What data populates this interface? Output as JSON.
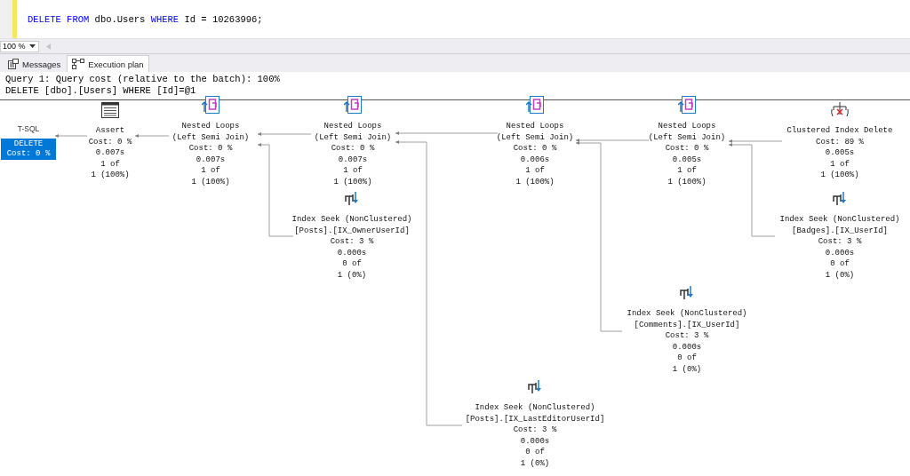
{
  "editor": {
    "code": [
      {
        "text": "DELETE FROM",
        "kind": "keyword"
      },
      {
        "text": " dbo.Users ",
        "kind": "plain"
      },
      {
        "text": "WHERE",
        "kind": "keyword"
      },
      {
        "text": " Id = 10263996;",
        "kind": "plain"
      }
    ]
  },
  "zoom": {
    "value": "100 %"
  },
  "tabs": [
    {
      "label": "Messages",
      "selected": false,
      "kind": "messages"
    },
    {
      "label": "Execution plan",
      "selected": true,
      "kind": "plan"
    }
  ],
  "plan": {
    "header": [
      "Query 1: Query cost (relative to the batch): 100%",
      "DELETE [dbo].[Users] WHERE [Id]=@1"
    ],
    "nodes": [
      {
        "kind": "root",
        "label": "T-SQL",
        "lines": [
          "DELETE",
          "Cost: 0 %"
        ],
        "selected": true
      },
      {
        "kind": "assert",
        "lines": [
          "Assert",
          "Cost: 0 %",
          "0.007s",
          "1 of",
          "1 (100%)"
        ]
      },
      {
        "kind": "loops",
        "lines": [
          "Nested Loops",
          "(Left Semi Join)",
          "Cost: 0 %",
          "0.007s",
          "1 of",
          "1 (100%)"
        ]
      },
      {
        "kind": "loops",
        "lines": [
          "Nested Loops",
          "(Left Semi Join)",
          "Cost: 0 %",
          "0.007s",
          "1 of",
          "1 (100%)"
        ]
      },
      {
        "kind": "loops",
        "lines": [
          "Nested Loops",
          "(Left Semi Join)",
          "Cost: 0 %",
          "0.006s",
          "1 of",
          "1 (100%)"
        ]
      },
      {
        "kind": "loops",
        "lines": [
          "Nested Loops",
          "(Left Semi Join)",
          "Cost: 0 %",
          "0.005s",
          "1 of",
          "1 (100%)"
        ]
      },
      {
        "kind": "delete",
        "lines": [
          "Clustered Index Delete",
          "Cost: 89 %",
          "0.005s",
          "1 of",
          "1 (100%)"
        ]
      },
      {
        "kind": "seek",
        "lines": [
          "Index Seek (NonClustered)",
          "[Posts].[IX_OwnerUserId]",
          "Cost: 3 %",
          "0.000s",
          "0 of",
          "1 (0%)"
        ]
      },
      {
        "kind": "seek",
        "lines": [
          "Index Seek (NonClustered)",
          "[Badges].[IX_UserId]",
          "Cost: 3 %",
          "0.000s",
          "0 of",
          "1 (0%)"
        ]
      },
      {
        "kind": "seek",
        "lines": [
          "Index Seek (NonClustered)",
          "[Comments].[IX_UserId]",
          "Cost: 3 %",
          "0.000s",
          "0 of",
          "1 (0%)"
        ]
      },
      {
        "kind": "seek",
        "lines": [
          "Index Seek (NonClustered)",
          "[Posts].[IX_LastEditorUserId]",
          "Cost: 3 %",
          "0.000s",
          "0 of",
          "1 (0%)"
        ]
      }
    ]
  }
}
